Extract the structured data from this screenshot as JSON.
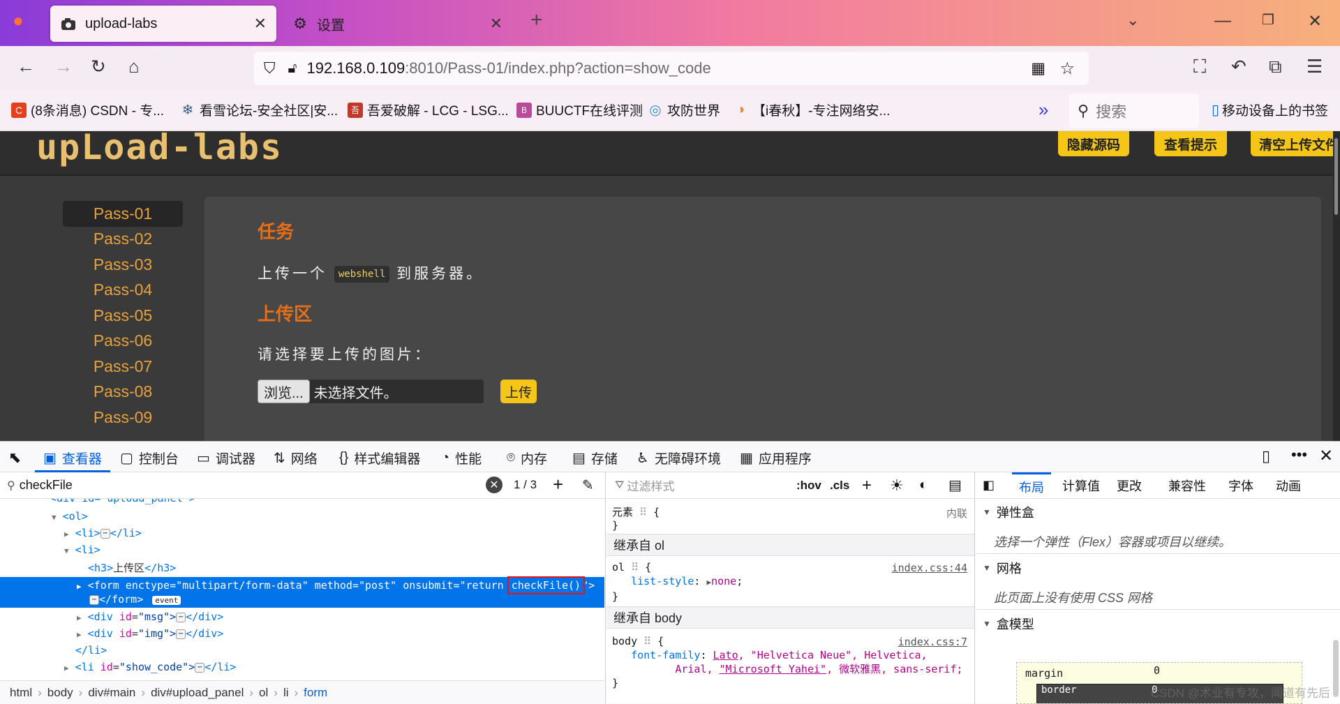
{
  "browser": {
    "tabs": [
      {
        "title": "upload-labs",
        "active": true
      },
      {
        "title": "设置",
        "active": false
      }
    ],
    "url": {
      "host": "192.168.0.109",
      "rest": ":8010/Pass-01/index.php?action=show_code"
    },
    "bookmarks": [
      {
        "label": "(8条消息) CSDN - 专...",
        "icon_color": "#e3401d",
        "icon_text": "C"
      },
      {
        "label": "看雪论坛-安全社区|安...",
        "icon_color": "#3b5b8a",
        "icon_text": "❄"
      },
      {
        "label": "吾爱破解 - LCG - LSG...",
        "icon_color": "#c0392b",
        "icon_text": "吾"
      },
      {
        "label": "BUUCTF在线评测",
        "icon_color": "#b94a9a",
        "icon_text": "B"
      },
      {
        "label": "攻防世界",
        "icon_color": "#3a8fd6",
        "icon_text": "◎"
      },
      {
        "label": "【i春秋】-专注网络安...",
        "icon_color": "#f08a24",
        "icon_text": "◑"
      }
    ],
    "search_placeholder": "搜索",
    "mobile_bookmarks": "移动设备上的书签"
  },
  "page": {
    "logo": "upLoad-labs",
    "header_buttons": [
      "隐藏源码",
      "查看提示",
      "清空上传文件"
    ],
    "passes": [
      "Pass-01",
      "Pass-02",
      "Pass-03",
      "Pass-04",
      "Pass-05",
      "Pass-06",
      "Pass-07",
      "Pass-08",
      "Pass-09"
    ],
    "task_heading": "任务",
    "task_text_before": "上传一个",
    "task_code": "webshell",
    "task_text_after": "到服务器。",
    "upload_heading": "上传区",
    "upload_prompt": "请选择要上传的图片：",
    "browse_label": "浏览...",
    "no_file": "未选择文件。",
    "upload_button": "上传"
  },
  "devtools": {
    "tabs": [
      "查看器",
      "控制台",
      "调试器",
      "网络",
      "样式编辑器",
      "性能",
      "内存",
      "存储",
      "无障碍环境",
      "应用程序"
    ],
    "search_value": "checkFile",
    "search_count": "1 / 3",
    "tree": {
      "l0": "<div id=\"upload_panel\">",
      "l1": "<ol>",
      "l2_open": "<li>",
      "l2_close": "</li>",
      "l3": "<li>",
      "l4_h3_open": "<h3>",
      "l4_h3_text": "上传区",
      "l4_h3_close": "</h3>",
      "form_tag": "<form",
      "form_attr1": "enctype",
      "form_val1": "\"multipart/form-data\"",
      "form_attr2": "method",
      "form_val2": "\"post\"",
      "form_attr3": "onsubmit",
      "form_val3": "\"return ",
      "form_highlight": "checkFile()",
      "form_val3_end": "\">",
      "form_close": "</form>",
      "event_badge": "event",
      "div_msg_open": "<div",
      "div_msg_attr": "id",
      "div_msg_val": "\"msg\">",
      "div_close": "</div>",
      "div_img_val": "\"img\">",
      "li_close": "</li>",
      "li_show_open": "<li",
      "li_show_val": "\"show_code\">"
    },
    "breadcrumb": [
      "html",
      "body",
      "div#main",
      "div#upload_panel",
      "ol",
      "li",
      "form"
    ],
    "rules": {
      "filter_placeholder": "过滤样式",
      "hov": ":hov",
      "cls": ".cls",
      "element_label": "元素",
      "inline": "内联",
      "inherit_ol": "继承自 ol",
      "ol_selector": "ol",
      "ol_source": "index.css:44",
      "ol_prop": "list-style",
      "ol_value": "none",
      "inherit_body": "继承自 body",
      "body_selector": "body",
      "body_source": "index.css:7",
      "body_prop": "font-family",
      "body_value_1a": "Lato",
      "body_value_1b": ", \"Helvetica Neue\", Helvetica,",
      "body_value_2a": "Arial, ",
      "body_value_2b": "\"Microsoft Yahei\"",
      "body_value_2c": ", 微软雅黑, sans-serif;"
    },
    "layout": {
      "tabs": [
        "布局",
        "计算值",
        "更改",
        "兼容性",
        "字体",
        "动画"
      ],
      "flex_heading": "弹性盒",
      "flex_text": "选择一个弹性（Flex）容器或项目以继续。",
      "grid_heading": "网格",
      "grid_text": "此页面上没有使用 CSS 网格",
      "box_heading": "盒模型",
      "margin_label": "margin",
      "margin_value": "0",
      "border_label": "border",
      "border_value": "0"
    }
  },
  "watermark": "CSDN @术业有专攻，闻道有先后"
}
